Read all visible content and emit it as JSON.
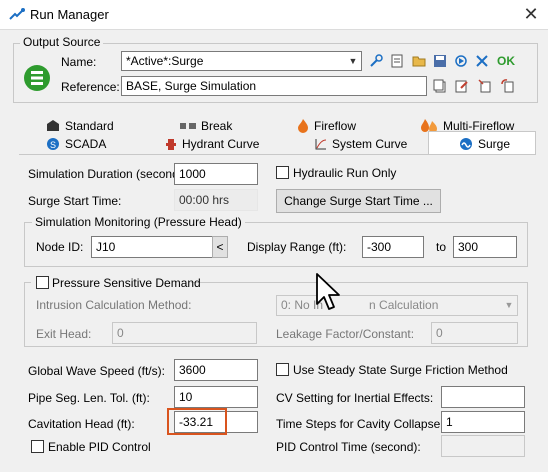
{
  "window": {
    "title": "Run Manager",
    "close_glyph": "✕"
  },
  "output_source": {
    "group_title": "Output Source",
    "name_label": "Name:",
    "name_value": "*Active*:Surge",
    "reference_label": "Reference:",
    "reference_value": "BASE, Surge Simulation",
    "ok_label": "OK",
    "toolbar_icons": [
      "wrench-icon",
      "report-icon",
      "folder-icon",
      "save-icon",
      "run-icon",
      "settings-icon"
    ],
    "ref_icons": [
      "copy-icon",
      "edit-icon",
      "reset-icon",
      "refresh-icon"
    ]
  },
  "tabs": {
    "row1": [
      "Standard",
      "Break",
      "Fireflow",
      "Multi-Fireflow"
    ],
    "row2": [
      "SCADA",
      "Hydrant Curve",
      "System Curve",
      "Surge"
    ],
    "selected": "Surge"
  },
  "surge": {
    "sim_duration_label": "Simulation Duration (second):",
    "sim_duration_value": "1000",
    "hydraulic_run_only_label": "Hydraulic Run Only",
    "surge_start_label": "Surge Start Time:",
    "surge_start_value": "00:00 hrs",
    "change_start_button": "Change Surge Start Time ...",
    "monitoring": {
      "group_title": "Simulation Monitoring (Pressure Head)",
      "node_id_label": "Node ID:",
      "node_id_value": "J10",
      "node_button": "<",
      "display_range_label": "Display Range (ft):",
      "range_from": "-300",
      "to_label": "to",
      "range_to": "300"
    },
    "psd": {
      "group_title": "Pressure Sensitive Demand",
      "intrusion_label": "Intrusion Calculation Method:",
      "intrusion_value": "0: No In",
      "intrusion_value_tail": "n Calculation",
      "exit_head_label": "Exit Head:",
      "exit_head_value": "0",
      "leakage_label": "Leakage Factor/Constant:",
      "leakage_value": "0"
    },
    "wave_speed_label": "Global Wave Speed (ft/s):",
    "wave_speed_value": "3600",
    "steady_friction_label": "Use Steady State Surge Friction Method",
    "pipe_seg_label": "Pipe Seg. Len. Tol. (ft):",
    "pipe_seg_value": "10",
    "cv_setting_label": "CV Setting for Inertial Effects:",
    "cv_setting_value": "",
    "cavitation_label": "Cavitation Head (ft):",
    "cavitation_value": "-33.21",
    "time_steps_label": "Time Steps for Cavity Collapse:",
    "time_steps_value": "1",
    "enable_pid_label": "Enable PID Control",
    "pid_time_label": "PID Control Time (second):",
    "pid_time_value": ""
  },
  "colors": {
    "highlight_box": "#d9541e",
    "ok_green": "#2e9b2e",
    "surge_tab_blue": "#1c6fc4"
  }
}
